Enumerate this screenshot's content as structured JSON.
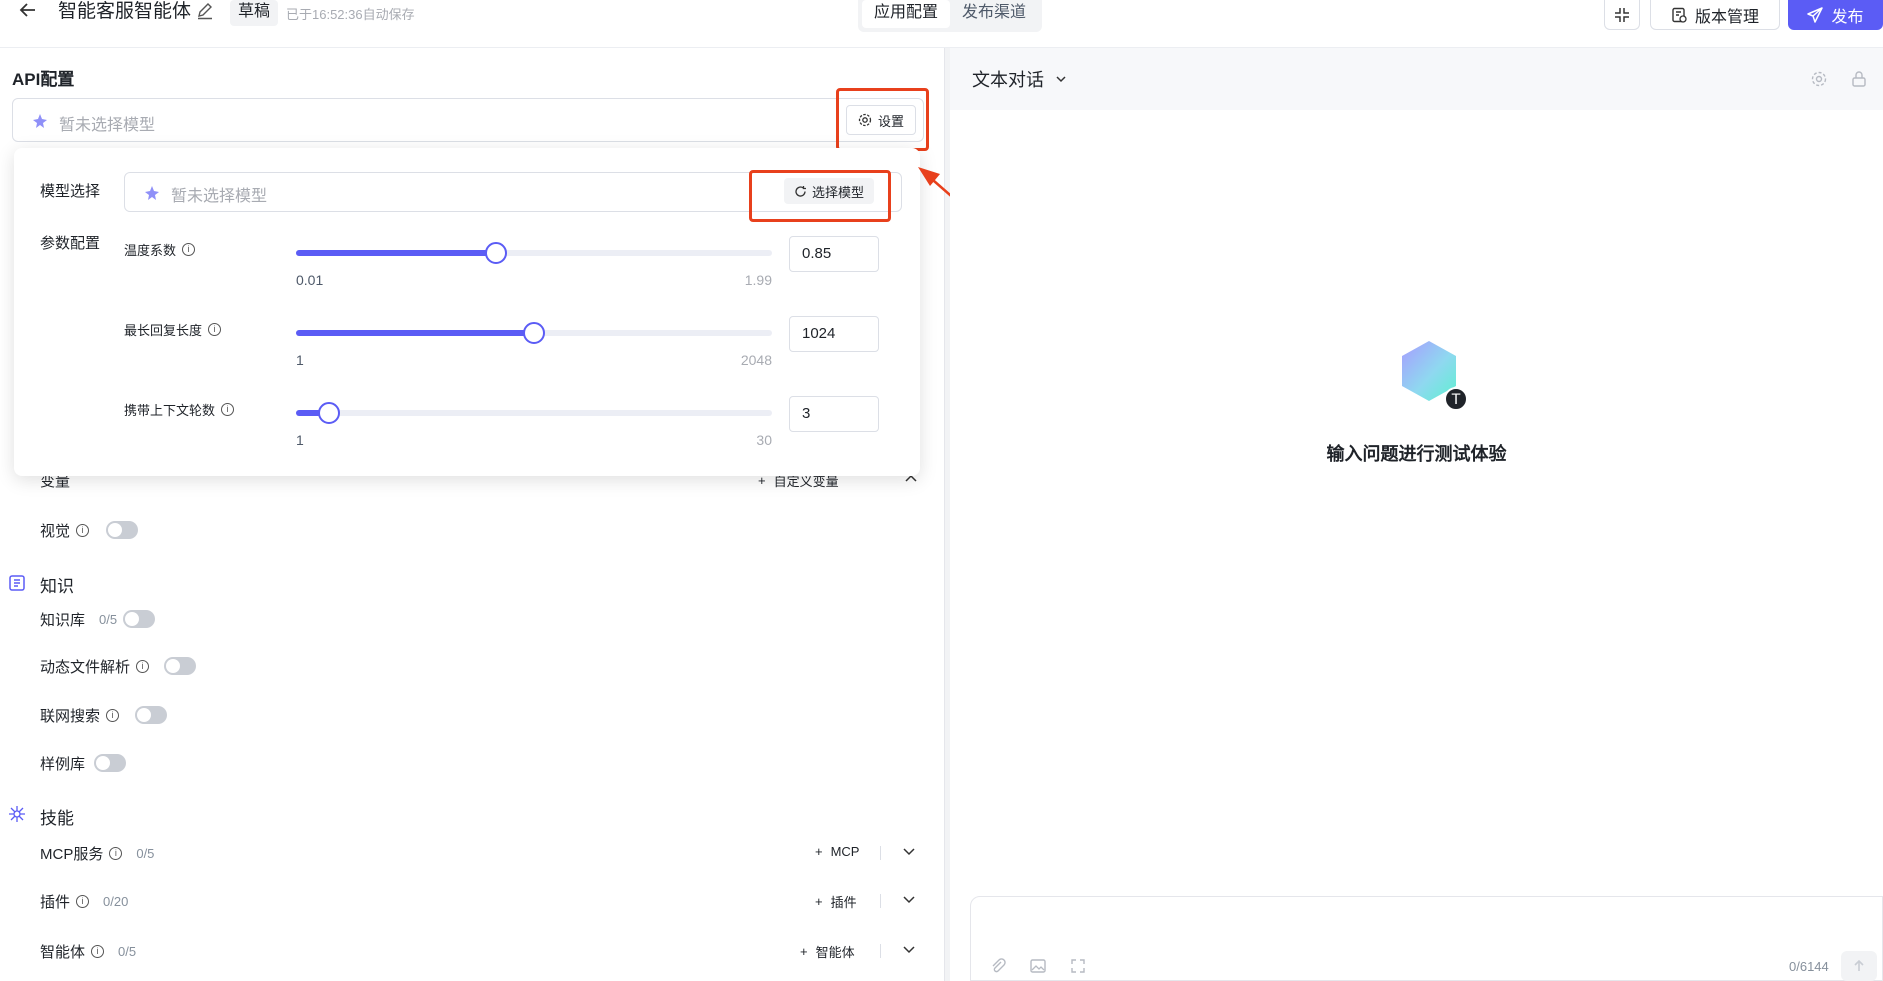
{
  "header": {
    "back_icon": "arrow-left-icon",
    "title": "智能客服智能体",
    "status": "草稿",
    "autosave": "已于16:52:36自动保存",
    "tabs": [
      {
        "label": "应用配置"
      },
      {
        "label": "发布渠道"
      }
    ],
    "version_label": "版本管理",
    "publish_label": "发布",
    "accent": "#5b5cf5"
  },
  "api": {
    "section_title": "API配置",
    "model_placeholder": "暂未选择模型",
    "settings_label": "设置"
  },
  "popover": {
    "model_label": "模型选择",
    "model_placeholder": "暂未选择模型",
    "choose_label": "选择模型",
    "params_label": "参数配置",
    "params": [
      {
        "label": "温度系数",
        "value": "0.85",
        "min": "0.01",
        "max": "1.99",
        "fraction": 0.42
      },
      {
        "label": "最长回复长度",
        "value": "1024",
        "min": "1",
        "max": "2048",
        "fraction": 0.5
      },
      {
        "label": "携带上下文轮数",
        "value": "3",
        "min": "1",
        "max": "30",
        "fraction": 0.07
      }
    ]
  },
  "variables": {
    "label": "变量",
    "add_label": "自定义变量"
  },
  "vision": {
    "label": "视觉"
  },
  "knowledge": {
    "title": "知识",
    "items": [
      {
        "label": "知识库",
        "count": "0/5"
      },
      {
        "label": "动态文件解析"
      },
      {
        "label": "联网搜索"
      },
      {
        "label": "样例库"
      }
    ]
  },
  "skills": {
    "title": "技能",
    "items": [
      {
        "label": "MCP服务",
        "count": "0/5",
        "add_label": "MCP"
      },
      {
        "label": "插件",
        "count": "0/20",
        "add_label": "插件"
      },
      {
        "label": "智能体",
        "count": "0/5",
        "add_label": "智能体"
      }
    ]
  },
  "chat": {
    "mode_label": "文本对话",
    "empty_text": "输入问题进行测试体验",
    "char_count": "0/6144"
  }
}
